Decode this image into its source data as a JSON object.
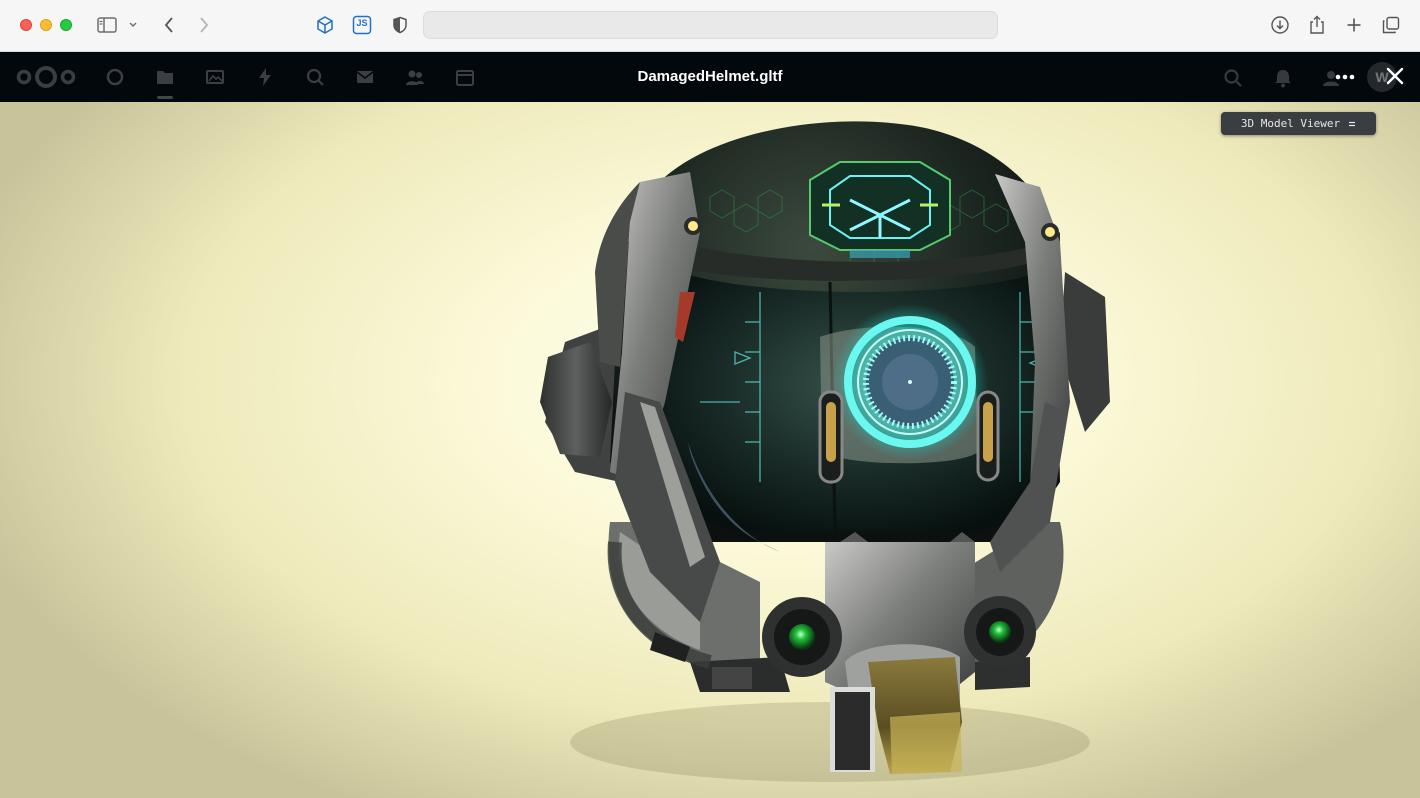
{
  "browser": {
    "address_value": "",
    "colors": {
      "close": "#ff5f57",
      "minimize": "#febc2e",
      "zoom": "#28c840",
      "extension_accent": "#1f6fd1"
    },
    "icons": [
      "sidebar-icon",
      "chevron-down-icon",
      "back-icon",
      "forward-icon",
      "cube-extension-icon",
      "js-extension-icon",
      "shield-icon",
      "download-icon",
      "share-icon",
      "new-tab-icon",
      "tab-overview-icon"
    ],
    "js_extension_label": "JS"
  },
  "app_header": {
    "title": "DamagedHelmet.gltf",
    "background": "#03080d",
    "dimmed_app_icons": [
      "dashboard-icon",
      "files-icon",
      "photos-icon",
      "activity-icon",
      "search-icon",
      "mail-icon",
      "contacts-icon",
      "calendar-icon"
    ],
    "dimmed_right_icons": [
      "search-icon",
      "notifications-icon",
      "contacts-icon"
    ],
    "avatar_initial": "W",
    "actions": [
      "more-icon",
      "close-icon"
    ]
  },
  "viewer": {
    "badge_label": "3D Model Viewer",
    "badge_icon": "menu-lines-icon",
    "model": "damaged-helmet"
  }
}
